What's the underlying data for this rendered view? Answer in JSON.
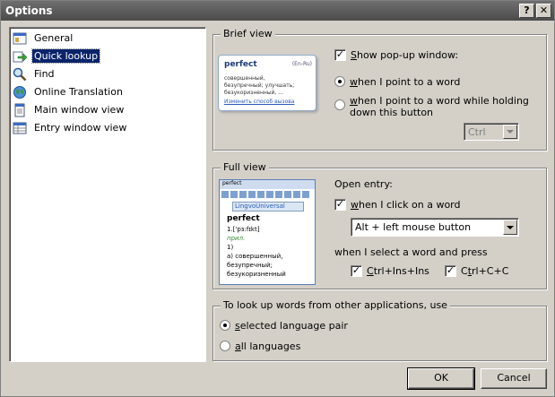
{
  "window": {
    "title": "Options",
    "help_label": "?",
    "close_label": "✕"
  },
  "nav": {
    "items": [
      {
        "label": "General",
        "icon": "general-icon"
      },
      {
        "label": "Quick lookup",
        "icon": "quick-lookup-icon",
        "selected": true
      },
      {
        "label": "Find",
        "icon": "find-icon"
      },
      {
        "label": "Online Translation",
        "icon": "globe-icon"
      },
      {
        "label": "Main window view",
        "icon": "document-icon"
      },
      {
        "label": "Entry window view",
        "icon": "table-icon"
      }
    ]
  },
  "brief_view": {
    "legend": "Brief view",
    "show_popup": {
      "label_u": "S",
      "label_rest": "how pop-up window:",
      "checked": true
    },
    "radio_point": {
      "label_u": "w",
      "label_rest": "hen I point to a word",
      "selected": true
    },
    "radio_hold": {
      "label_u": "w",
      "label_rest": "hen I point to a word while holding down this button",
      "selected": false
    },
    "hold_key": {
      "value": "Ctrl",
      "disabled": true
    },
    "preview": {
      "word": "perfect",
      "lang": "(En-Ru)",
      "lines": [
        "совершенный,",
        "безупречный; улучшать;",
        "безукоризненный, ..."
      ],
      "link": "Изменить способ вызова"
    }
  },
  "full_view": {
    "legend": "Full view",
    "open_entry_label": "Open entry:",
    "click_word": {
      "label_u": "w",
      "label_rest": "hen I click on a word",
      "checked": true
    },
    "click_combo": {
      "value": "Alt + left mouse button"
    },
    "select_label": "when I select a word and press",
    "ctrl_ins": {
      "label_pre": "",
      "label_u": "C",
      "label_rest": "trl+Ins+Ins",
      "checked": true
    },
    "ctrl_c": {
      "label_pre": "C",
      "label_u": "t",
      "label_rest": "rl+C+C",
      "checked": true
    },
    "preview": {
      "title": "perfect",
      "dict": "LingvoUniversal",
      "word": "perfect",
      "lines": [
        "1.['pɜ:fɪkt]",
        "прил.",
        "1)",
        "а) совершенный,",
        "безупречный;",
        "безукоризненный"
      ]
    }
  },
  "lookup_other": {
    "legend": "To look up words from other applications, use",
    "radio_selected_pair": {
      "label_u": "s",
      "label_rest": "elected language pair",
      "selected": true
    },
    "radio_all": {
      "label_u": "a",
      "label_rest": "ll languages",
      "selected": false
    }
  },
  "buttons": {
    "ok": "OK",
    "cancel": "Cancel"
  }
}
